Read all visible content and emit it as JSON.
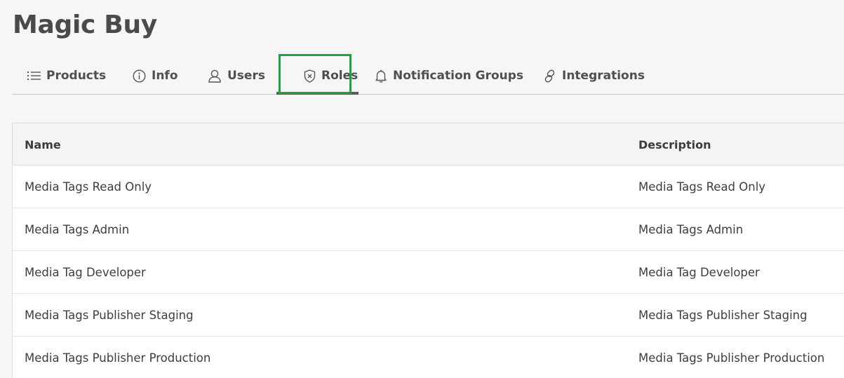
{
  "app": {
    "title": "Magic Buy"
  },
  "tabs": [
    {
      "label": "Products",
      "icon": "list-icon"
    },
    {
      "label": "Info",
      "icon": "info-icon"
    },
    {
      "label": "Users",
      "icon": "user-icon"
    },
    {
      "label": "Roles",
      "icon": "shield-icon",
      "active": true
    },
    {
      "label": "Notification Groups",
      "icon": "bell-icon"
    },
    {
      "label": "Integrations",
      "icon": "link-icon"
    }
  ],
  "table": {
    "columns": [
      "Name",
      "Description"
    ],
    "rows": [
      {
        "name": "Media Tags Read Only",
        "description": "Media Tags Read Only"
      },
      {
        "name": "Media Tags Admin",
        "description": "Media Tags Admin"
      },
      {
        "name": "Media Tag Developer",
        "description": "Media Tag Developer"
      },
      {
        "name": "Media Tags Publisher Staging",
        "description": "Media Tags Publisher Staging"
      },
      {
        "name": "Media Tags Publisher Production",
        "description": "Media Tags Publisher Production"
      }
    ]
  },
  "colors": {
    "highlight": "#1fa33a",
    "active_underline": "#5a5a5a"
  }
}
